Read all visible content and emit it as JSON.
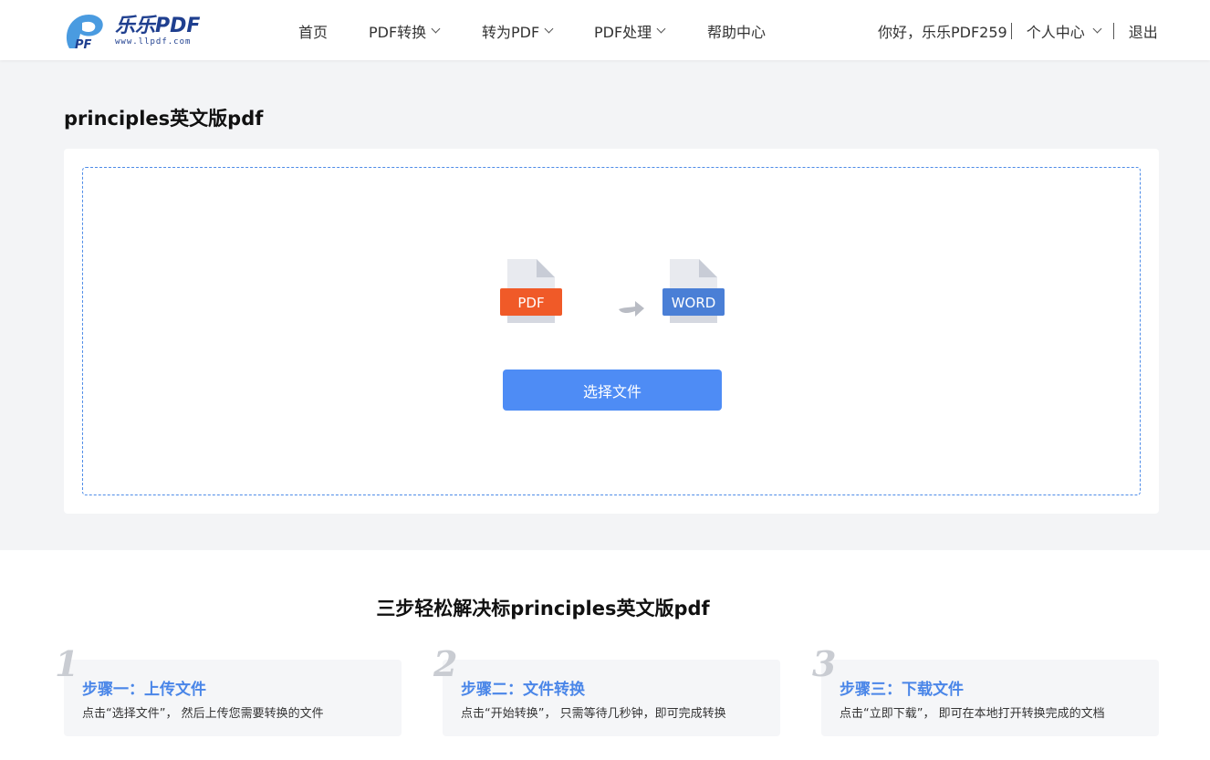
{
  "header": {
    "logo_name": "乐乐PDF",
    "logo_url": "www.llpdf.com",
    "nav": [
      {
        "label": "首页",
        "has_dropdown": false
      },
      {
        "label": "PDF转换",
        "has_dropdown": true
      },
      {
        "label": "转为PDF",
        "has_dropdown": true
      },
      {
        "label": "PDF处理",
        "has_dropdown": true
      },
      {
        "label": "帮助中心",
        "has_dropdown": false
      }
    ],
    "greeting": "你好，乐乐PDF259",
    "user_center": "个人中心",
    "logout": "退出"
  },
  "main": {
    "title": "principles英文版pdf",
    "source_format": "PDF",
    "target_format": "WORD",
    "select_button": "选择文件"
  },
  "steps": {
    "title": "三步轻松解决标principles英文版pdf",
    "items": [
      {
        "num": "1",
        "head": "步骤一：上传文件",
        "desc": "点击“选择文件”， 然后上传您需要转换的文件"
      },
      {
        "num": "2",
        "head": "步骤二：文件转换",
        "desc": "点击“开始转换”， 只需等待几秒钟，即可完成转换"
      },
      {
        "num": "3",
        "head": "步骤三：下载文件",
        "desc": "点击“立即下载”， 即可在本地打开转换完成的文档"
      }
    ]
  },
  "colors": {
    "accent": "#4e8cf5",
    "pdf_badge": "#f05a28",
    "word_badge": "#4a7fd6",
    "step_head": "#4a86e8"
  }
}
